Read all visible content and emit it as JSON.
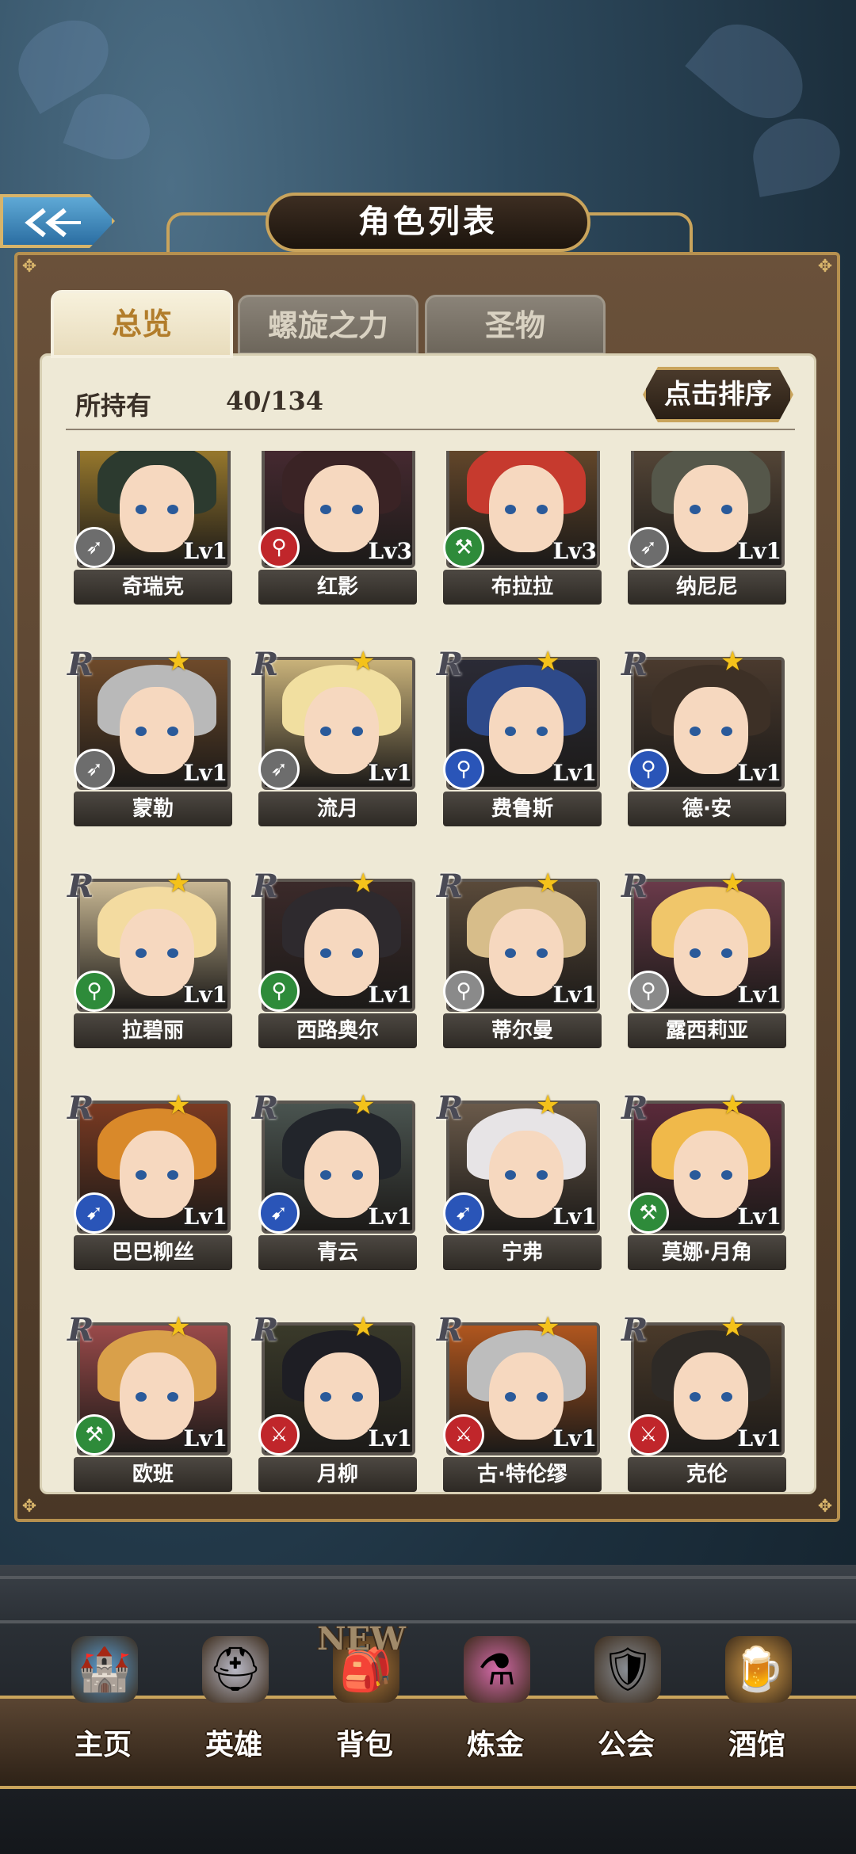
{
  "header": {
    "title": "角色列表",
    "back_icon": "double-chevron-left-icon"
  },
  "tabs": [
    {
      "label": "总览",
      "active": true
    },
    {
      "label": "螺旋之力",
      "active": false
    },
    {
      "label": "圣物",
      "active": false
    }
  ],
  "summary": {
    "owned_label": "所持有",
    "owned_count": "40/134",
    "sort_label": "点击排序"
  },
  "rarity_mark": "R",
  "characters": [
    {
      "name": "奇瑞克",
      "level": "Lv1",
      "class_icon": "bow-icon",
      "class_color": "#6d6d6d",
      "rarity": "",
      "star": false,
      "hair": "#2c3a2f",
      "bg": "#a4822f"
    },
    {
      "name": "红影",
      "level": "Lv3",
      "class_icon": "staff-icon",
      "class_color": "#c0262b",
      "rarity": "",
      "star": false,
      "hair": "#3a2325",
      "bg": "#4a2b33"
    },
    {
      "name": "布拉拉",
      "level": "Lv3",
      "class_icon": "axe-icon",
      "class_color": "#2e8b3a",
      "rarity": "",
      "star": false,
      "hair": "#c63a2e",
      "bg": "#6a4b2c"
    },
    {
      "name": "纳尼尼",
      "level": "Lv1",
      "class_icon": "bow-icon",
      "class_color": "#6d6d6d",
      "rarity": "",
      "star": false,
      "hair": "#55574a",
      "bg": "#5a4a3a"
    },
    {
      "name": "蒙勒",
      "level": "Lv1",
      "class_icon": "bow-icon",
      "class_color": "#6d6d6d",
      "rarity": "R",
      "star": true,
      "hair": "#b9b9b9",
      "bg": "#6e4a2a"
    },
    {
      "name": "流月",
      "level": "Lv1",
      "class_icon": "bow-icon",
      "class_color": "#6d6d6d",
      "rarity": "R",
      "star": true,
      "hair": "#f1dfa0",
      "bg": "#c9b27a"
    },
    {
      "name": "费鲁斯",
      "level": "Lv1",
      "class_icon": "staff-icon",
      "class_color": "#2a55b8",
      "rarity": "R",
      "star": true,
      "hair": "#2e4a8a",
      "bg": "#2b2b36"
    },
    {
      "name": "德·安",
      "level": "Lv1",
      "class_icon": "staff-icon",
      "class_color": "#2a55b8",
      "rarity": "R",
      "star": true,
      "hair": "#3d3026",
      "bg": "#4a3a2e"
    },
    {
      "name": "拉碧丽",
      "level": "Lv1",
      "class_icon": "staff-icon",
      "class_color": "#2e8b3a",
      "rarity": "R",
      "star": true,
      "hair": "#f3dba0",
      "bg": "#c9b894"
    },
    {
      "name": "西路奥尔",
      "level": "Lv1",
      "class_icon": "staff-icon",
      "class_color": "#2e8b3a",
      "rarity": "R",
      "star": true,
      "hair": "#2e2a2e",
      "bg": "#3b2a2a"
    },
    {
      "name": "蒂尔曼",
      "level": "Lv1",
      "class_icon": "staff-icon",
      "class_color": "#8a8a8a",
      "rarity": "R",
      "star": true,
      "hair": "#d7bd8a",
      "bg": "#5a4a3a"
    },
    {
      "name": "露西莉亚",
      "level": "Lv1",
      "class_icon": "staff-icon",
      "class_color": "#8a8a8a",
      "rarity": "R",
      "star": true,
      "hair": "#f0c66a",
      "bg": "#6a3a4a"
    },
    {
      "name": "巴巴柳丝",
      "level": "Lv1",
      "class_icon": "spear-icon",
      "class_color": "#2a55b8",
      "rarity": "R",
      "star": true,
      "hair": "#d9892a",
      "bg": "#7a3a22"
    },
    {
      "name": "青云",
      "level": "Lv1",
      "class_icon": "spear-icon",
      "class_color": "#2a55b8",
      "rarity": "R",
      "star": true,
      "hair": "#22252b",
      "bg": "#4a5450"
    },
    {
      "name": "宁弗",
      "level": "Lv1",
      "class_icon": "spear-icon",
      "class_color": "#2a55b8",
      "rarity": "R",
      "star": true,
      "hair": "#e7e4e6",
      "bg": "#6a5a4a"
    },
    {
      "name": "莫娜·月角",
      "level": "Lv1",
      "class_icon": "axe-icon",
      "class_color": "#2e8b3a",
      "rarity": "R",
      "star": true,
      "hair": "#f0b94a",
      "bg": "#5a2a3a"
    },
    {
      "name": "欧班",
      "level": "Lv1",
      "class_icon": "axe-icon",
      "class_color": "#2e8b3a",
      "rarity": "R",
      "star": true,
      "hair": "#d9a04a",
      "bg": "#9a4a4a"
    },
    {
      "name": "月柳",
      "level": "Lv1",
      "class_icon": "sword-icon",
      "class_color": "#c0262b",
      "rarity": "R",
      "star": true,
      "hair": "#1e1e24",
      "bg": "#3a3a2a"
    },
    {
      "name": "古·特伦缪",
      "level": "Lv1",
      "class_icon": "sword-icon",
      "class_color": "#c0262b",
      "rarity": "R",
      "star": true,
      "hair": "#bdbdbd",
      "bg": "#b0561e"
    },
    {
      "name": "克伦",
      "level": "Lv1",
      "class_icon": "sword-icon",
      "class_color": "#c0262b",
      "rarity": "R",
      "star": true,
      "hair": "#2e2a26",
      "bg": "#4a3a2a"
    }
  ],
  "nav": {
    "new_badge": "NEW",
    "items": [
      {
        "label": "主页",
        "icon": "castle-icon"
      },
      {
        "label": "英雄",
        "icon": "helmet-icon"
      },
      {
        "label": "背包",
        "icon": "backpack-icon"
      },
      {
        "label": "炼金",
        "icon": "potion-icon"
      },
      {
        "label": "公会",
        "icon": "shield-icon"
      },
      {
        "label": "酒馆",
        "icon": "beer-mug-icon"
      }
    ]
  }
}
